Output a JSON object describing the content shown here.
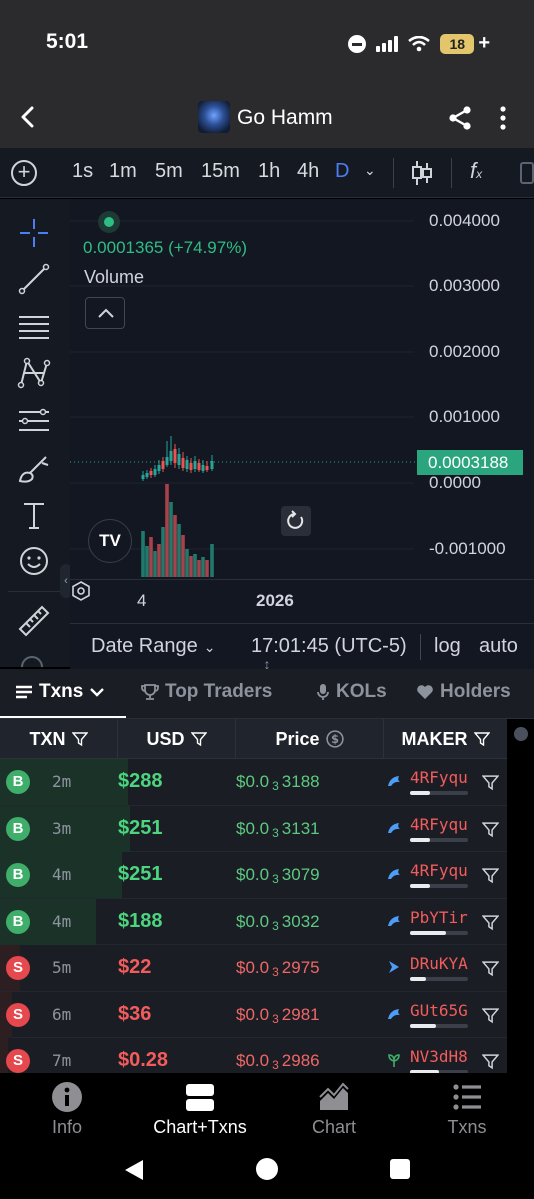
{
  "status": {
    "time": "5:01",
    "battery": "18"
  },
  "header": {
    "title": "Go Hamm"
  },
  "toolbar": {
    "timeframes": [
      "1s",
      "1m",
      "5m",
      "15m",
      "1h",
      "4h",
      "D"
    ],
    "active_timeframe": "D"
  },
  "chart": {
    "price_legend": "0.0001365 (+74.97%)",
    "volume_label": "Volume",
    "y_ticks": [
      "0.004000",
      "0.003000",
      "0.002000",
      "0.001000",
      "0.0000",
      "-0.001000"
    ],
    "current_price": "0.0003188",
    "x_ticks": [
      "4",
      "2026"
    ],
    "date_range_label": "Date Range",
    "clock": "17:01:45 (UTC-5)",
    "log_label": "log",
    "auto_label": "auto",
    "logo_text": "TV"
  },
  "tabs": {
    "txns": "Txns",
    "top_traders": "Top Traders",
    "kols": "KOLs",
    "holders": "Holders"
  },
  "table": {
    "headers": {
      "txn": "TXN",
      "usd": "USD",
      "price": "Price",
      "maker": "MAKER"
    },
    "rows": [
      {
        "type": "B",
        "age": "2m",
        "usd": "$288",
        "price_pre": "$0.0",
        "price_sub": "3",
        "price_post": "3188",
        "maker": "4RFyqu",
        "maker_share": 0.35
      },
      {
        "type": "B",
        "age": "3m",
        "usd": "$251",
        "price_pre": "$0.0",
        "price_sub": "3",
        "price_post": "3131",
        "maker": "4RFyqu",
        "maker_share": 0.35
      },
      {
        "type": "B",
        "age": "4m",
        "usd": "$251",
        "price_pre": "$0.0",
        "price_sub": "3",
        "price_post": "3079",
        "maker": "4RFyqu",
        "maker_share": 0.35
      },
      {
        "type": "B",
        "age": "4m",
        "usd": "$188",
        "price_pre": "$0.0",
        "price_sub": "3",
        "price_post": "3032",
        "maker": "PbYTir",
        "maker_share": 0.62
      },
      {
        "type": "S",
        "age": "5m",
        "usd": "$22",
        "price_pre": "$0.0",
        "price_sub": "3",
        "price_post": "2975",
        "maker": "DRuKYA",
        "maker_share": 0.28
      },
      {
        "type": "S",
        "age": "6m",
        "usd": "$36",
        "price_pre": "$0.0",
        "price_sub": "3",
        "price_post": "2981",
        "maker": "GUt65G",
        "maker_share": 0.45
      },
      {
        "type": "S",
        "age": "7m",
        "usd": "$0.28",
        "price_pre": "$0.0",
        "price_sub": "3",
        "price_post": "2986",
        "maker": "NV3dH8",
        "maker_share": 0.5
      }
    ]
  },
  "bottom_nav": {
    "info": "Info",
    "chart_txns": "Chart+Txns",
    "chart": "Chart",
    "txns": "Txns"
  },
  "colors": {
    "buy": "#4cd47e",
    "sell": "#f25c5c",
    "accent": "#4d7cf5",
    "price_badge": "#2ba57e"
  },
  "icons": [
    "back-arrow-icon",
    "share-icon",
    "more-vertical-icon",
    "plus-circle-icon",
    "candlestick-icon",
    "function-icon",
    "crosshair-icon",
    "trend-line-icon",
    "fib-icon",
    "pattern-icon",
    "ruler-lines-icon",
    "brush-icon",
    "text-icon",
    "emoji-icon",
    "measure-icon",
    "filter-icon",
    "dollar-circle-icon",
    "info-icon",
    "chart-icon",
    "list-icon"
  ]
}
